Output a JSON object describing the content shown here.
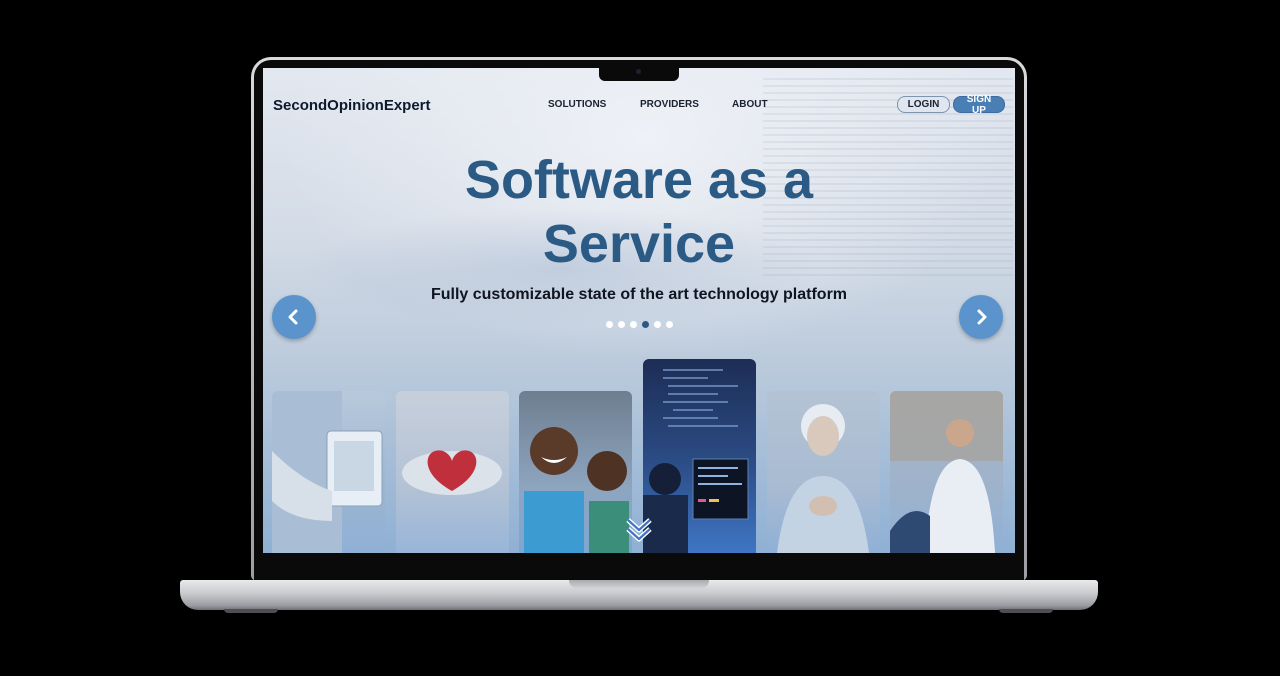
{
  "brand": {
    "name": "SecondOpinionExpert"
  },
  "nav": {
    "links": [
      "SOLUTIONS",
      "PROVIDERS",
      "ABOUT"
    ],
    "login_label": "LOGIN",
    "signup_label": "SIGN UP"
  },
  "hero": {
    "title": "Software as a Service",
    "subtitle": "Fully customizable state of the art technology platform"
  },
  "carousel": {
    "prev_icon": "chevron-left-icon",
    "next_icon": "chevron-right-icon",
    "scroll_icon": "double-chevron-down-icon",
    "dot_count": 6,
    "active_dot": 4,
    "cards": [
      "doctor-tablet-photo",
      "hands-heart-photo",
      "smiling-children-photo",
      "developer-code-photo",
      "senior-woman-photo",
      "doctor-consultation-photo"
    ],
    "active_card": 4
  },
  "colors": {
    "accent": "#2b5a85",
    "button": "#4a7fb5",
    "arrow": "#5b93cc"
  }
}
